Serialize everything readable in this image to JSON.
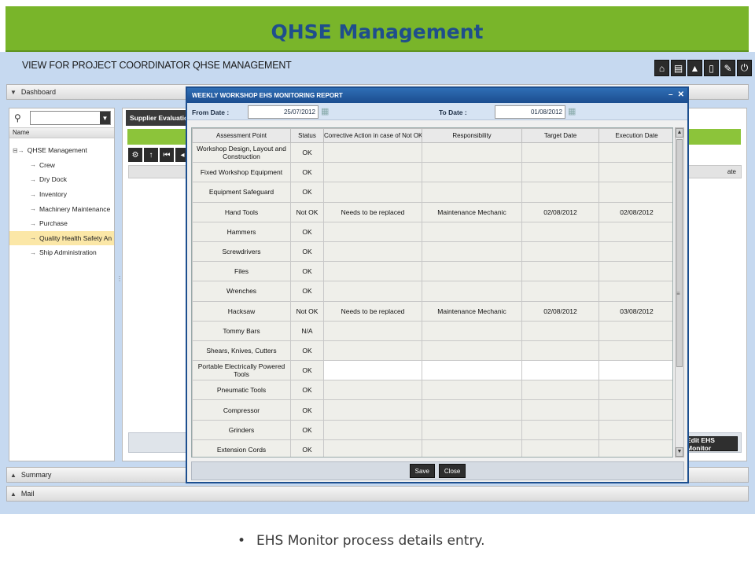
{
  "slide": {
    "title": "QHSE Management",
    "caption": "EHS Monitor process details entry."
  },
  "app": {
    "view_title": "VIEW FOR PROJECT COORDINATOR QHSE MANAGEMENT",
    "top_icons": [
      "home-icon",
      "print-icon",
      "warning-icon",
      "document-icon",
      "edit-icon",
      "power-icon"
    ],
    "panels": {
      "dashboard": "Dashboard",
      "summary": "Summary",
      "mail": "Mail"
    },
    "tree": {
      "header": "Name",
      "root": "QHSE Management",
      "items": [
        {
          "label": "Crew",
          "selected": false
        },
        {
          "label": "Dry Dock",
          "selected": false
        },
        {
          "label": "Inventory",
          "selected": false
        },
        {
          "label": "Machinery Maintenance",
          "selected": false
        },
        {
          "label": "Purchase",
          "selected": false
        },
        {
          "label": "Quality Health Safety An",
          "selected": true
        },
        {
          "label": "Ship Administration",
          "selected": false
        }
      ]
    },
    "background_tab": {
      "label": "Supplier Evaluation",
      "grid_column_fragment": "ate",
      "edit_button": "Edit EHS Monitor"
    }
  },
  "modal": {
    "title": "WEEKLY WORKSHOP EHS MONITORING REPORT",
    "from_label": "From Date :",
    "from_value": "25/07/2012",
    "to_label": "To Date :",
    "to_value": "01/08/2012",
    "columns": [
      "Assessment Point",
      "Status",
      "Corrective Action in case of Not OK",
      "Responsibility",
      "Target Date",
      "Execution Date"
    ],
    "rows": [
      [
        "Workshop Design, Layout and Construction",
        "OK",
        "",
        "",
        "",
        ""
      ],
      [
        "Fixed Workshop Equipment",
        "OK",
        "",
        "",
        "",
        ""
      ],
      [
        "Equipment Safeguard",
        "OK",
        "",
        "",
        "",
        ""
      ],
      [
        "Hand Tools",
        "Not OK",
        "Needs to be replaced",
        "Maintenance Mechanic",
        "02/08/2012",
        "02/08/2012"
      ],
      [
        "Hammers",
        "OK",
        "",
        "",
        "",
        ""
      ],
      [
        "Screwdrivers",
        "OK",
        "",
        "",
        "",
        ""
      ],
      [
        "Files",
        "OK",
        "",
        "",
        "",
        ""
      ],
      [
        "Wrenches",
        "OK",
        "",
        "",
        "",
        ""
      ],
      [
        "Hacksaw",
        "Not OK",
        "Needs to be replaced",
        "Maintenance Mechanic",
        "02/08/2012",
        "03/08/2012"
      ],
      [
        "Tommy Bars",
        "N/A",
        "",
        "",
        "",
        ""
      ],
      [
        "Shears, Knives, Cutters",
        "OK",
        "",
        "",
        "",
        ""
      ],
      [
        "Portable Electrically Powered Tools",
        "OK",
        "",
        "",
        "",
        ""
      ],
      [
        "Pneumatic Tools",
        "OK",
        "",
        "",
        "",
        ""
      ],
      [
        "Compressor",
        "OK",
        "",
        "",
        "",
        ""
      ],
      [
        "Grinders",
        "OK",
        "",
        "",
        "",
        ""
      ],
      [
        "Extension Cords",
        "OK",
        "",
        "",
        "",
        ""
      ]
    ],
    "white_row_index": 11,
    "buttons": {
      "save": "Save",
      "close": "Close"
    }
  },
  "colors": {
    "banner": "#79b52a",
    "title_text": "#1f4e8c",
    "modal_titlebar": "#1d4f8f"
  }
}
